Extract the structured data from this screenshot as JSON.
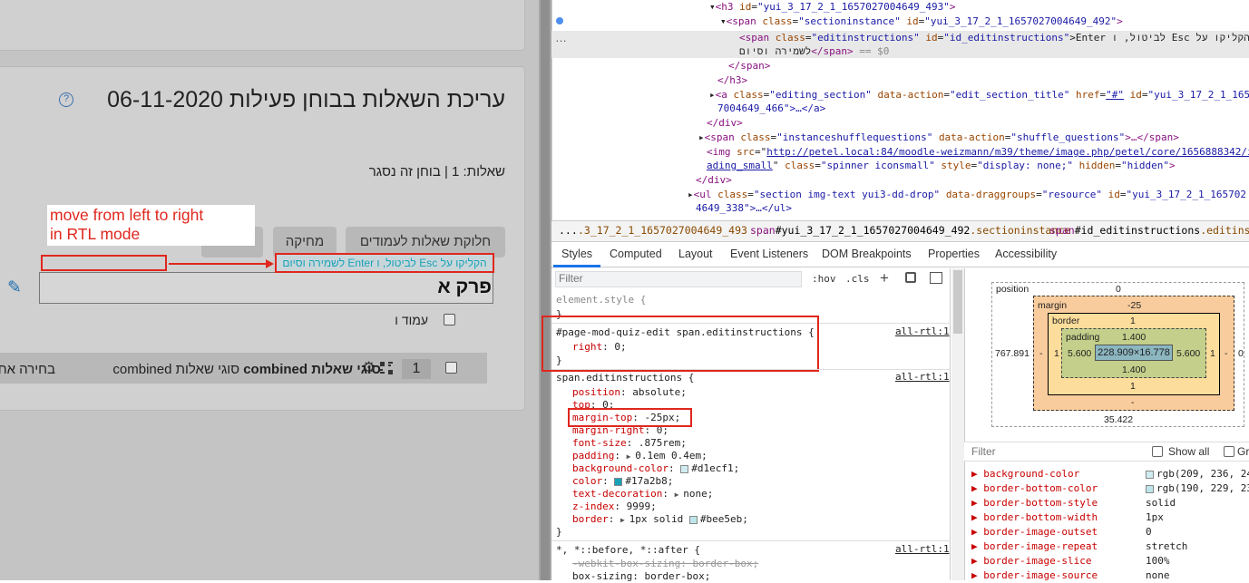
{
  "moodle": {
    "page_title": "עריכת השאלות בבוחן פעילות 06-11-2020",
    "help_icon": "?",
    "quiz_info": "שאלות: 1 | בוחן זה נסגר",
    "repaginate_label": "חלוקת שאלות לעמודים",
    "delete_label": "מחיקה",
    "edit_instructions": "הקליקו על Esc לביטול, ו Enter לשמירה וסיום",
    "section_name": "פרק א",
    "page_label": "עמוד ו",
    "question_number": "1",
    "question_title_bold": "סוגי שאלות combined",
    "question_title_rest": "סוגי שאלות combined",
    "question_desc": "בחירה אחת",
    "icons": {
      "help": "help-icon",
      "pencil": "pencil-icon",
      "gear": "gear-icon",
      "qtype": "question-type-icon"
    }
  },
  "annotation": {
    "line1": "move from left to right",
    "line2": "in RTL mode",
    "color": "#e0271d"
  },
  "devtools": {
    "dom": {
      "line1": {
        "tag_open": "<h3 ",
        "a1": "id",
        "v1": "\"yui_3_17_2_1_1657027004649_493\"",
        "tag_close": ">"
      },
      "line2": {
        "tag_open": "<span ",
        "a1": "class",
        "v1": "\"sectioninstance\"",
        "a2": "id",
        "v2": "\"yui_3_17_2_1_1657027004649_492\"",
        "tag_close": ">"
      },
      "line3": {
        "tag_open": "<span ",
        "a1": "class",
        "v1": "\"editinstructions\"",
        "a2": "id",
        "v2": "\"id_editinstructions\"",
        "text": "הקליקו על Esc לביטול, ו Enter"
      },
      "line3b": {
        "text": "לשמירה וסיום",
        "close": "</span>",
        "eq": " == $0"
      },
      "line4": "</span>",
      "line5": "</h3>",
      "line6": {
        "tag_open": "<a ",
        "a1": "class",
        "v1": "\"editing_section\"",
        "a2": "data-action",
        "v2": "\"edit_section_title\"",
        "a3": "href",
        "v3": "\"#\"",
        "a4": "id",
        "v4": "\"yui_3_17_2_1_165"
      },
      "line6b": "7004649_466\">…</a>",
      "line7": "</div>",
      "line8": {
        "tag_open": "<span ",
        "a1": "class",
        "v1": "\"instanceshufflequestions\"",
        "a2": "data-action",
        "v2": "\"shuffle_questions\"",
        "rest": ">…</span>"
      },
      "line9": {
        "tag_open": "<img ",
        "a1": "src",
        "v1": "http://petel.local:84/moodle-weizmann/m39/theme/image.php/petel/core/1656888342/i"
      },
      "line9b": {
        "v1": "ading_small",
        "a2": "class",
        "v2": "\"spinner iconsmall\"",
        "a3": "style",
        "v3": "\"display: none;\"",
        "a4": "hidden",
        "v4": "\"hidden\""
      },
      "line10": "</div>",
      "line11": {
        "tag_open": "<ul ",
        "a1": "class",
        "v1": "\"section img-text yui3-dd-drop\"",
        "a2": "data-draggroups",
        "v2": "\"resource\"",
        "a3": "id",
        "v3": "\"yui_3_17_2_1_165702"
      },
      "line11b": "4649_338\">…</ul>"
    },
    "breadcrumbs": {
      "ellipsis": "...",
      "c1": ".3_17_2_1_1657027004649_493",
      "c2_tag": "span",
      "c2_rest": "#yui_3_17_2_1_1657027004649_492",
      "c2_cls": ".sectioninstance",
      "c3_tag": "span",
      "c3_id": "#id_editinstructions",
      "c3_cls": ".editinstructions"
    },
    "tabs": [
      "Styles",
      "Computed",
      "Layout",
      "Event Listeners",
      "DOM Breakpoints",
      "Properties",
      "Accessibility"
    ],
    "filter_placeholder": "Filter",
    "hov": ":hov",
    "cls": ".cls",
    "rules": {
      "element_style": "element.style {",
      "close": "}",
      "rule1_selector": "#page-mod-quiz-edit span.editinstructions {",
      "rule1_prop": "right",
      "rule1_val": "0;",
      "source": "all-rtl:1",
      "rule2_selector": "span.editinstructions {",
      "props": [
        {
          "n": "position",
          "v": "absolute;"
        },
        {
          "n": "top",
          "v": "0;"
        },
        {
          "n": "margin-top",
          "v": "-25px;"
        },
        {
          "n": "margin-right",
          "v": "0;"
        },
        {
          "n": "font-size",
          "v": ".875rem;"
        },
        {
          "n": "padding",
          "v": "0.1em 0.4em;"
        },
        {
          "n": "background-color",
          "v": "#d1ecf1;"
        },
        {
          "n": "color",
          "v": "#17a2b8;"
        },
        {
          "n": "text-decoration",
          "v": "none;"
        },
        {
          "n": "z-index",
          "v": "9999;"
        },
        {
          "n": "border",
          "v": "1px solid ",
          "v2": "#bee5eb;"
        }
      ],
      "rule3_selector": "*, *::before, *::after {",
      "rule3_p1": "-webkit-box-sizing: border-box;",
      "rule3_p2": "box-sizing: border-box;"
    },
    "box_model": {
      "position_label": "position",
      "position_top": "0",
      "position_left": "767.891",
      "position_right": "0",
      "position_bottom": "35.422",
      "margin_label": "margin",
      "margin_top": "-25",
      "margin_left": "-",
      "margin_right": "-",
      "margin_bottom": "-",
      "border_label": "border",
      "border_val": "1",
      "padding_label": "padding",
      "padding_top": "1.400",
      "padding_side": "5.600",
      "padding_bottom": "1.400",
      "content": "228.909×16.778"
    },
    "computed": {
      "filter_placeholder": "Filter",
      "show_all": "Show all",
      "group": "Gr",
      "rows": [
        {
          "n": "background-color",
          "v": "rgb(209, 236, 24"
        },
        {
          "n": "border-bottom-color",
          "v": "rgb(190, 229, 23"
        },
        {
          "n": "border-bottom-style",
          "v": "solid"
        },
        {
          "n": "border-bottom-width",
          "v": "1px"
        },
        {
          "n": "border-image-outset",
          "v": "0"
        },
        {
          "n": "border-image-repeat",
          "v": "stretch"
        },
        {
          "n": "border-image-slice",
          "v": "100%"
        },
        {
          "n": "border-image-source",
          "v": "none"
        }
      ]
    },
    "colors": {
      "bg_color": "#d1ecf1",
      "text_color": "#17a2b8",
      "border_color": "#bee5eb",
      "highlight": "#e0271d"
    }
  }
}
